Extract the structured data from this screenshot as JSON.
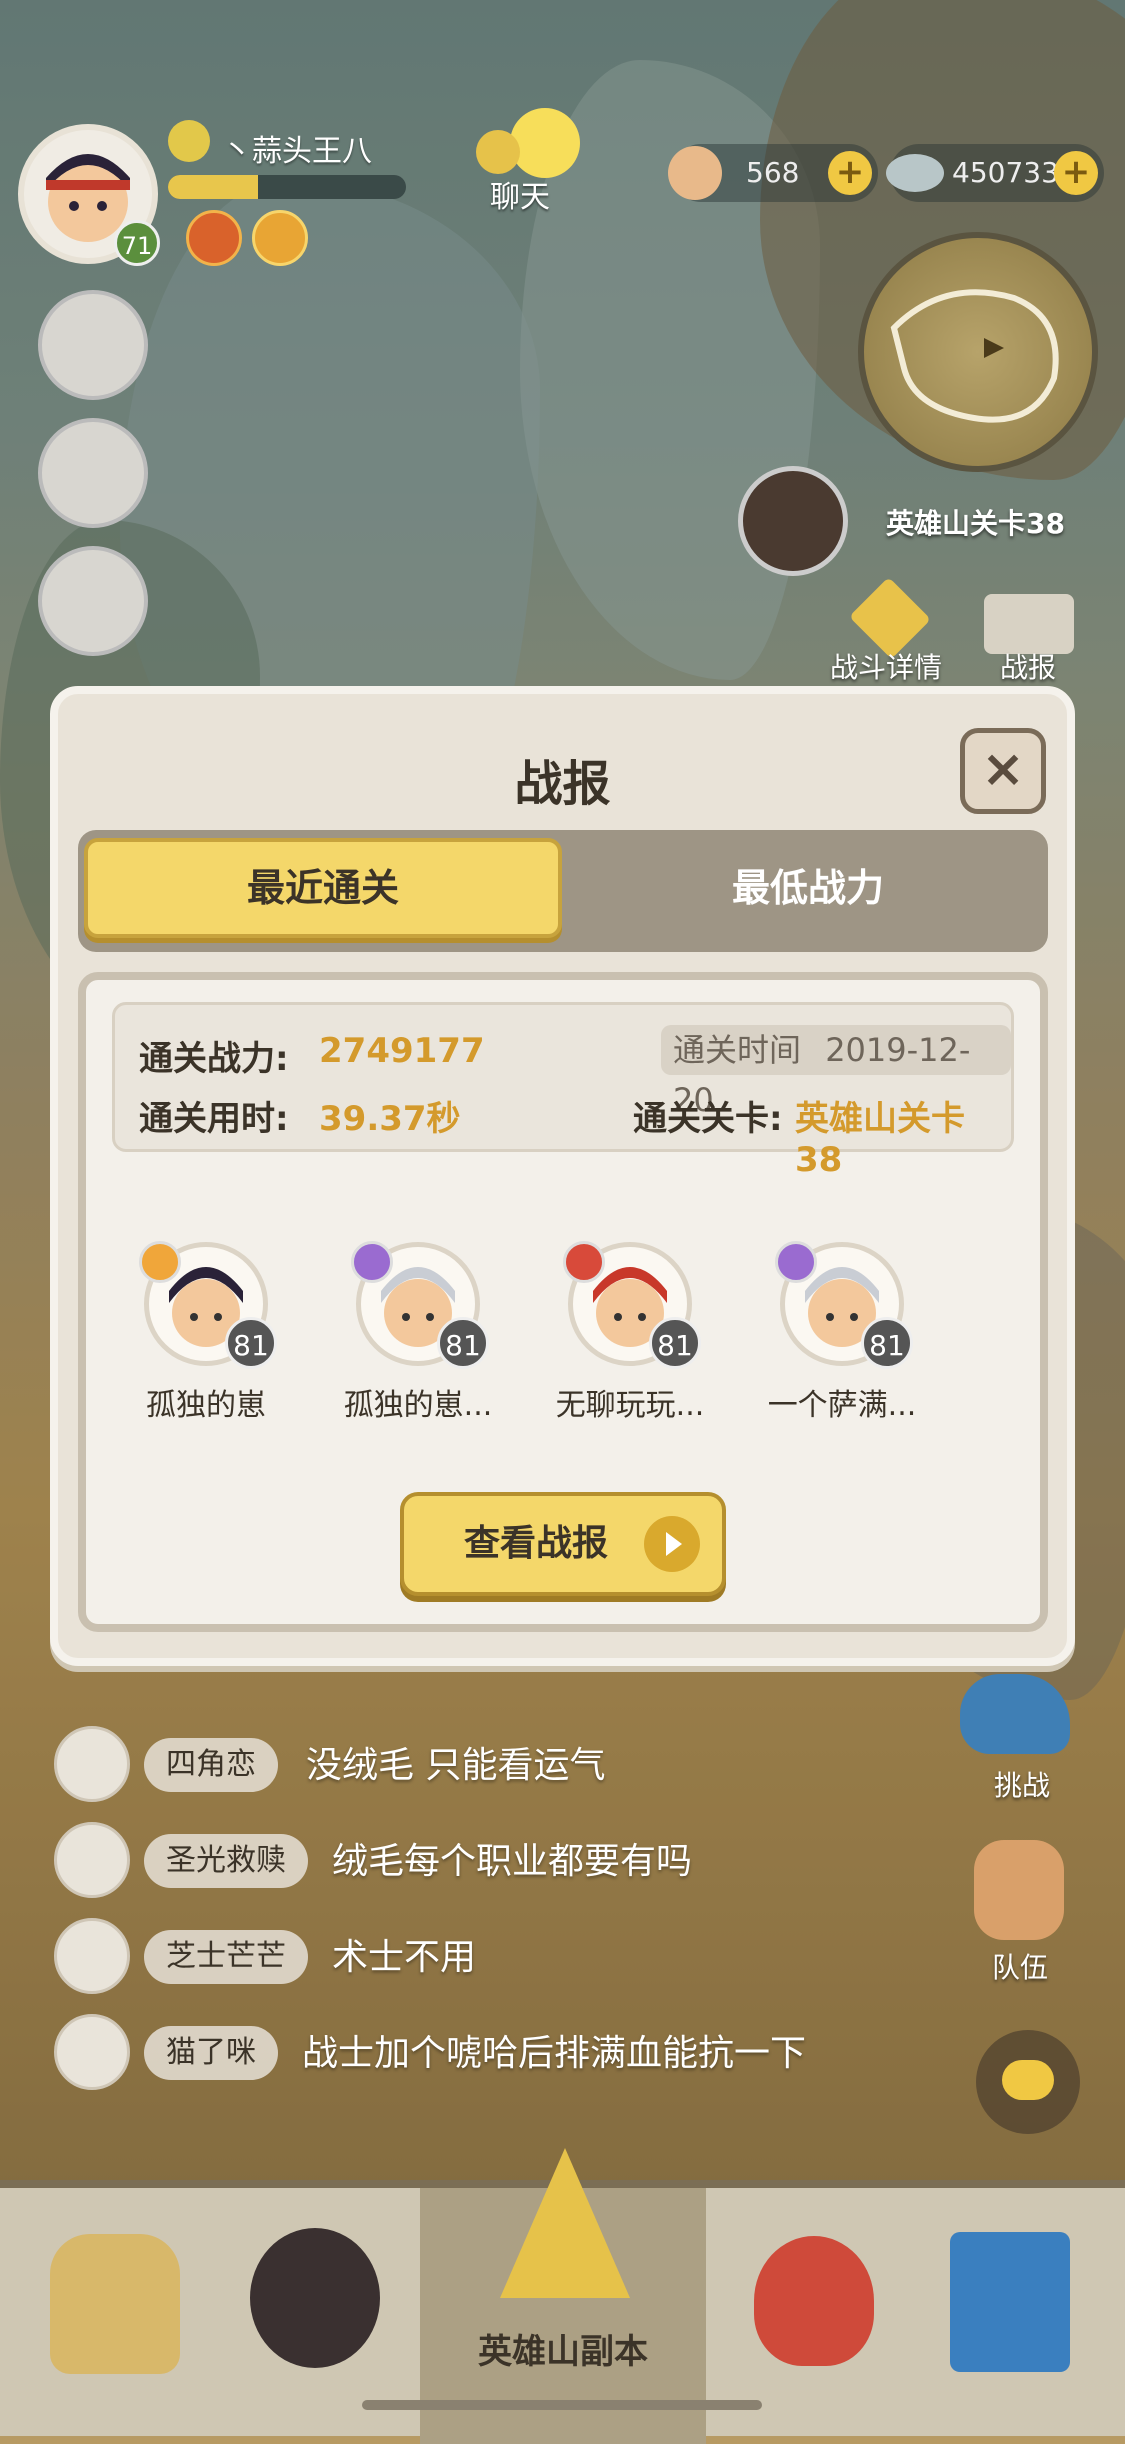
{
  "player": {
    "name": "丶蒜头王八",
    "level": "71",
    "xp_fraction": 0.38
  },
  "header": {
    "chat_label": "聊天",
    "shells": "568",
    "pearls": "450733"
  },
  "map": {
    "stage_label": "英雄山关卡38"
  },
  "side": {
    "battle_detail": "战斗详情",
    "battle_report": "战报",
    "challenge": "挑战",
    "team": "队伍"
  },
  "modal": {
    "title": "战报",
    "close_icon": "close-icon",
    "tabs": [
      {
        "label": "最近通关"
      },
      {
        "label": "最低战力"
      }
    ],
    "info": {
      "power_label": "通关战力:",
      "power_value": "2749177",
      "time_label": "通关时间",
      "time_value": "2019-12-20",
      "duration_label": "通关用时:",
      "duration_value": "39.37秒",
      "stage_label": "通关关卡:",
      "stage_value": "英雄山关卡38"
    },
    "heroes": [
      {
        "name": "孤独的崽",
        "level": "81",
        "class_color": "#f0a63a",
        "hair": "#2a2238"
      },
      {
        "name": "孤独的崽...",
        "level": "81",
        "class_color": "#9a6bd0",
        "hair": "#c9cdd4"
      },
      {
        "name": "无聊玩玩...",
        "level": "81",
        "class_color": "#d84a3a",
        "hair": "#c8382a"
      },
      {
        "name": "一个萨满...",
        "level": "81",
        "class_color": "#9a6bd0",
        "hair": "#c9cdd4"
      }
    ],
    "view_button": "查看战报"
  },
  "chat": [
    {
      "name": "四角恋",
      "msg": "没绒毛 只能看运气"
    },
    {
      "name": "圣光救赎",
      "msg": "绒毛每个职业都要有吗"
    },
    {
      "name": "芝士芒芒",
      "msg": "术士不用"
    },
    {
      "name": "猫了咪",
      "msg": "战士加个唬哈后排满血能抗一下"
    }
  ],
  "bottom_nav": {
    "center_label": "英雄山副本"
  }
}
